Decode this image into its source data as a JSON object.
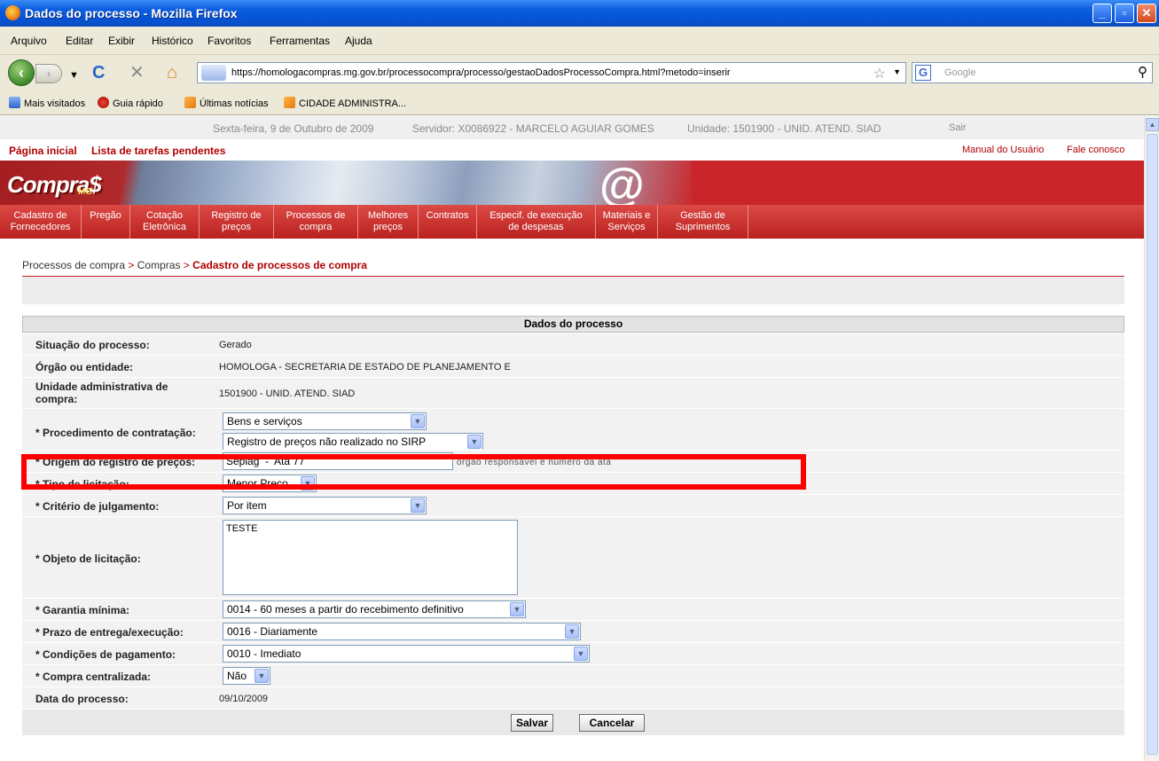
{
  "window": {
    "title": "Dados do processo - Mozilla Firefox",
    "controls": {
      "minimize": "_",
      "maximize": "▫",
      "close": "✕"
    }
  },
  "menu": [
    "Arquivo",
    "Editar",
    "Exibir",
    "Histórico",
    "Favoritos",
    "Ferramentas",
    "Ajuda"
  ],
  "navbar": {
    "url": "https://homologacompras.mg.gov.br/processocompra/processo/gestaoDadosProcessoCompra.html?metodo=inserir",
    "search_placeholder": "Google"
  },
  "bookmarks": [
    "Mais visitados",
    "Guia rápido",
    "Últimas notícias",
    "CIDADE ADMINISTRA..."
  ],
  "infobar": {
    "date": "Sexta-feira, 9 de Outubro de 2009",
    "server": "Servidor: X0086922 - MARCELO AGUIAR GOMES",
    "unit": "Unidade: 1501900 - UNID. ATEND. SIAD",
    "logout": "Sair"
  },
  "toplinks": {
    "home": "Página inicial",
    "tasks": "Lista de tarefas pendentes",
    "manual": "Manual do Usuário",
    "contact": "Fale conosco"
  },
  "banner": {
    "logo": "Compra$",
    "logo_sub": "MG"
  },
  "mainnav": [
    [
      "Cadastro de",
      "Fornecedores"
    ],
    [
      "Pregão",
      ""
    ],
    [
      "Cotação",
      "Eletrônica"
    ],
    [
      "Registro de",
      "preços"
    ],
    [
      "Processos de",
      "compra"
    ],
    [
      "Melhores",
      "preços"
    ],
    [
      "Contratos",
      ""
    ],
    [
      "Especif. de execução",
      "de despesas"
    ],
    [
      "Materiais e",
      "Serviços"
    ],
    [
      "Gestão de",
      "Suprimentos"
    ]
  ],
  "breadcrumb": {
    "item1": "Processos de compra",
    "item2": "Compras",
    "current": "Cadastro de processos de compra",
    "sep": ">"
  },
  "form": {
    "header": "Dados do processo",
    "situacao": {
      "label": "Situação do processo:",
      "value": "Gerado"
    },
    "orgao": {
      "label": "Órgão ou entidade:",
      "value": "HOMOLOGA - SECRETARIA DE ESTADO DE PLANEJAMENTO E"
    },
    "unidade": {
      "label1": "Unidade administrativa de",
      "label2": "compra:",
      "value": "1501900 - UNID. ATEND. SIAD"
    },
    "procedimento": {
      "label": "* Procedimento de contratação:",
      "value": "Bens e serviços",
      "value2": "Registro de preços não realizado no SIRP"
    },
    "origem": {
      "label": "* Origem do registro de preços:",
      "value": "Seplag  -  Ata 77",
      "hint": "órgão responsável e número da ata"
    },
    "tipo": {
      "label": "* Tipo de licitação:",
      "value": "Menor Preço"
    },
    "criterio": {
      "label": "* Critério de julgamento:",
      "value": "Por item"
    },
    "objeto": {
      "label": "* Objeto de licitação:",
      "value": "TESTE"
    },
    "garantia": {
      "label": "* Garantia mínima:",
      "value": "0014 - 60 meses a partir do recebimento definitivo"
    },
    "prazo": {
      "label": "* Prazo de entrega/execução:",
      "value": "0016 - Diariamente"
    },
    "condicoes": {
      "label": "* Condições de pagamento:",
      "value": "0010 - Imediato"
    },
    "centralizada": {
      "label": "* Compra centralizada:",
      "value": "Não"
    },
    "data": {
      "label": "Data do processo:",
      "value": "09/10/2009"
    },
    "save": "Salvar",
    "cancel": "Cancelar"
  }
}
